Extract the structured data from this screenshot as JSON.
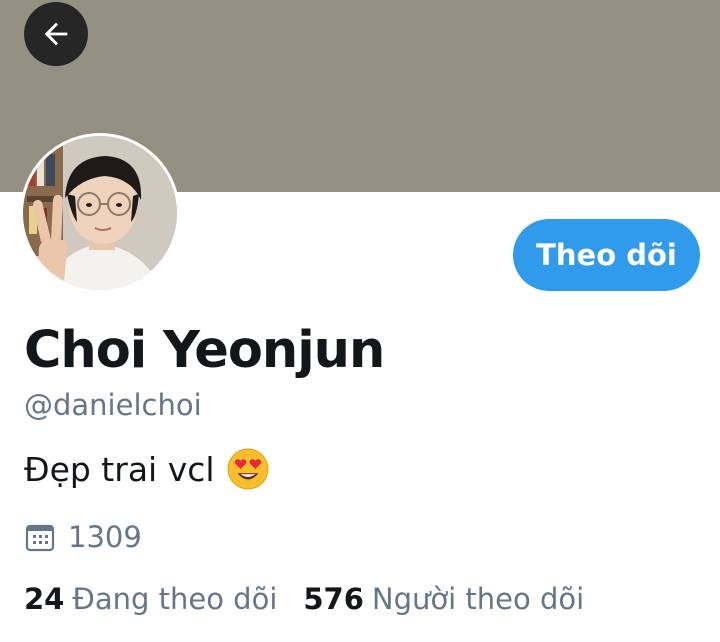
{
  "profile": {
    "display_name": "Choi Yeonjun",
    "handle": "@danielchoi",
    "bio": "Đẹp trai vcl",
    "bio_emoji": "smiling-face-with-heart-eyes-icon",
    "meta_value": "1309",
    "meta_icon": "calendar-icon"
  },
  "actions": {
    "follow_label": "Theo dõi",
    "back_icon": "back-arrow-icon"
  },
  "stats": {
    "following_count": "24",
    "following_label": "Đang theo dõi",
    "followers_count": "576",
    "followers_label": "Người theo dõi"
  },
  "colors": {
    "banner": "#949182",
    "accent": "#2f9bea",
    "secondary_text": "#657786",
    "primary_text": "#14171a"
  }
}
